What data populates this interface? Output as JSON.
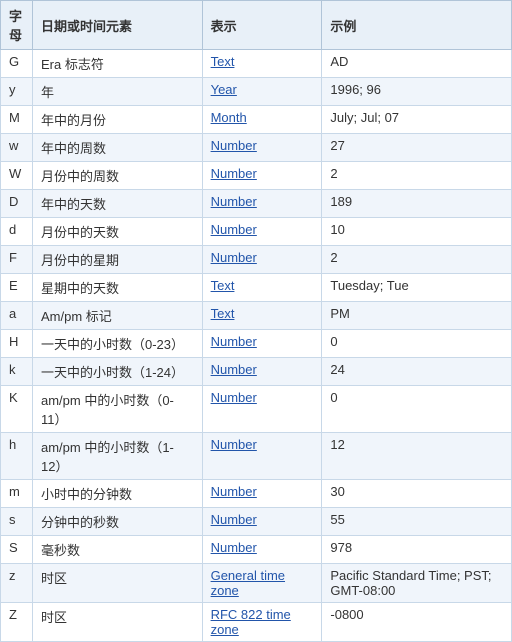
{
  "table": {
    "headers": [
      "字母",
      "日期或时间元素",
      "表示",
      "示例"
    ],
    "rows": [
      {
        "letter": "G",
        "desc": "Era 标志符",
        "format_text": "Text",
        "format_link": "#",
        "example": "AD"
      },
      {
        "letter": "y",
        "desc": "年",
        "format_text": "Year",
        "format_link": "#",
        "example": "1996; 96"
      },
      {
        "letter": "M",
        "desc": "年中的月份",
        "format_text": "Month",
        "format_link": "#",
        "example": "July; Jul; 07"
      },
      {
        "letter": "w",
        "desc": "年中的周数",
        "format_text": "Number",
        "format_link": "#",
        "example": "27"
      },
      {
        "letter": "W",
        "desc": "月份中的周数",
        "format_text": "Number",
        "format_link": "#",
        "example": "2"
      },
      {
        "letter": "D",
        "desc": "年中的天数",
        "format_text": "Number",
        "format_link": "#",
        "example": "189"
      },
      {
        "letter": "d",
        "desc": "月份中的天数",
        "format_text": "Number",
        "format_link": "#",
        "example": "10"
      },
      {
        "letter": "F",
        "desc": "月份中的星期",
        "format_text": "Number",
        "format_link": "#",
        "example": "2"
      },
      {
        "letter": "E",
        "desc": "星期中的天数",
        "format_text": "Text",
        "format_link": "#",
        "example": "Tuesday; Tue"
      },
      {
        "letter": "a",
        "desc": "Am/pm 标记",
        "format_text": "Text",
        "format_link": "#",
        "example": "PM"
      },
      {
        "letter": "H",
        "desc": "一天中的小时数（0-23）",
        "format_text": "Number",
        "format_link": "#",
        "example": "0"
      },
      {
        "letter": "k",
        "desc": "一天中的小时数（1-24）",
        "format_text": "Number",
        "format_link": "#",
        "example": "24"
      },
      {
        "letter": "K",
        "desc": "am/pm 中的小时数（0-11）",
        "format_text": "Number",
        "format_link": "#",
        "example": "0"
      },
      {
        "letter": "h",
        "desc": "am/pm 中的小时数（1-12）",
        "format_text": "Number",
        "format_link": "#",
        "example": "12"
      },
      {
        "letter": "m",
        "desc": "小时中的分钟数",
        "format_text": "Number",
        "format_link": "#",
        "example": "30"
      },
      {
        "letter": "s",
        "desc": "分钟中的秒数",
        "format_text": "Number",
        "format_link": "#",
        "example": "55"
      },
      {
        "letter": "S",
        "desc": "毫秒数",
        "format_text": "Number",
        "format_link": "#",
        "example": "978"
      },
      {
        "letter": "z",
        "desc": "时区",
        "format_text": "General time zone",
        "format_link": "#",
        "example": "Pacific Standard Time; PST; GMT-08:00"
      },
      {
        "letter": "Z",
        "desc": "时区",
        "format_text": "RFC 822 time zone",
        "format_link": "#",
        "example": "-0800"
      }
    ]
  }
}
